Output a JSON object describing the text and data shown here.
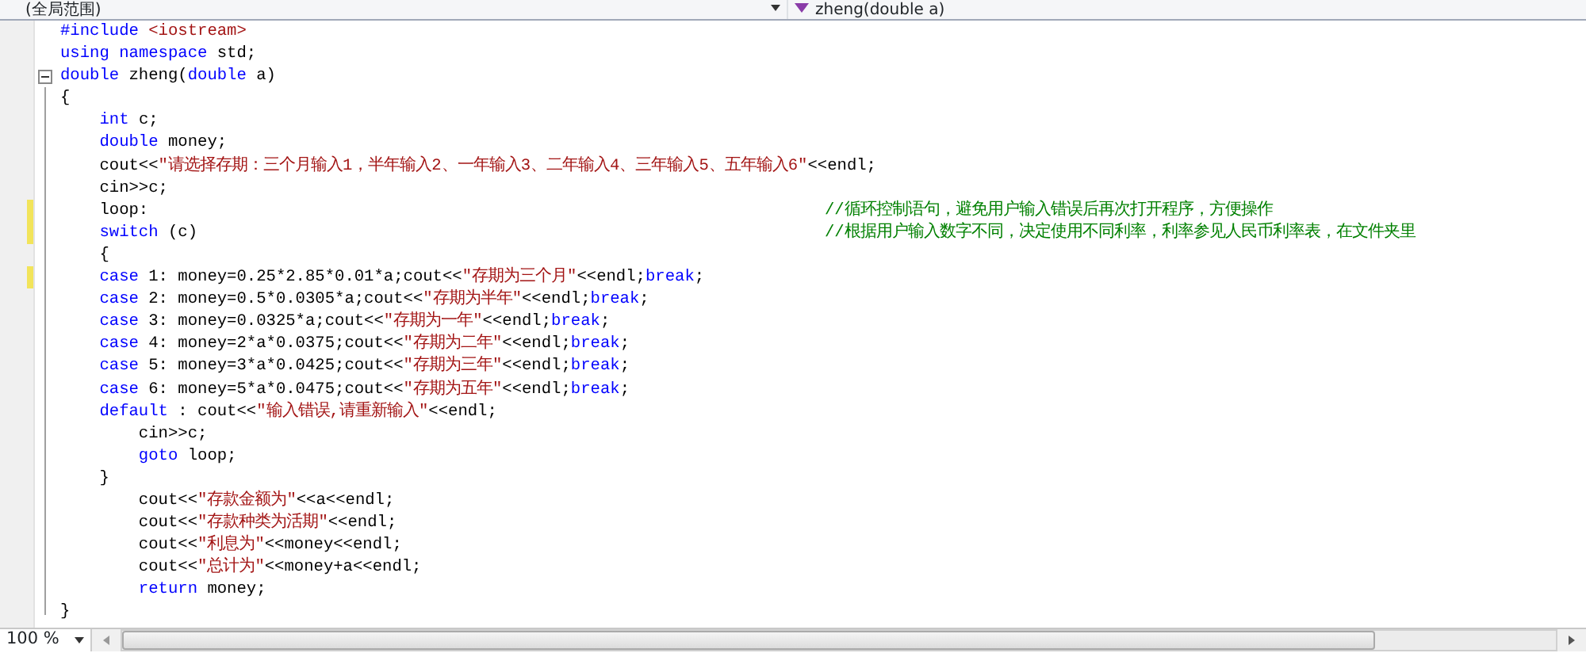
{
  "navigation": {
    "scope": "(全局范围)",
    "member": "zheng(double a)"
  },
  "lines": [
    {
      "changed": false,
      "fold_start": false,
      "tokens": [
        {
          "kind": "kw",
          "text": "#include"
        },
        {
          "kind": "str",
          "text": " <iostream>"
        }
      ]
    },
    {
      "changed": false,
      "fold_start": false,
      "tokens": [
        {
          "kind": "kw",
          "text": "using"
        },
        {
          "kind": "kw",
          "text": " namespace"
        },
        {
          "kind": "plain",
          "text": " std;"
        }
      ]
    },
    {
      "changed": false,
      "fold_start": true,
      "tokens": [
        {
          "kind": "kw",
          "text": "double"
        },
        {
          "kind": "plain",
          "text": " zheng("
        },
        {
          "kind": "kw",
          "text": "double"
        },
        {
          "kind": "plain",
          "text": " a)"
        }
      ]
    },
    {
      "changed": false,
      "fold_start": false,
      "tokens": [
        {
          "kind": "plain",
          "text": "{"
        }
      ]
    },
    {
      "changed": false,
      "fold_start": false,
      "tokens": [
        {
          "kind": "kw",
          "text": "    int"
        },
        {
          "kind": "plain",
          "text": " c;"
        }
      ]
    },
    {
      "changed": false,
      "fold_start": false,
      "tokens": [
        {
          "kind": "kw",
          "text": "    double"
        },
        {
          "kind": "plain",
          "text": " money;"
        }
      ]
    },
    {
      "changed": false,
      "fold_start": false,
      "tokens": [
        {
          "kind": "plain",
          "text": "    cout<<"
        },
        {
          "kind": "str",
          "text": "\"请选择存期：三个月输入1，半年输入2、一年输入3、二年输入4、三年输入5、五年输入6\""
        },
        {
          "kind": "plain",
          "text": "<<endl;"
        }
      ]
    },
    {
      "changed": false,
      "fold_start": false,
      "tokens": [
        {
          "kind": "plain",
          "text": "    cin>>c;"
        }
      ]
    },
    {
      "changed": true,
      "fold_start": false,
      "tokens": [
        {
          "kind": "plain",
          "text": "    loop:                                                                     "
        },
        {
          "kind": "cmt",
          "text": "//循环控制语句，避免用户输入错误后再次打开程序，方便操作"
        }
      ]
    },
    {
      "changed": true,
      "fold_start": false,
      "tokens": [
        {
          "kind": "kw",
          "text": "    switch"
        },
        {
          "kind": "plain",
          "text": " (c)                                                                "
        },
        {
          "kind": "cmt",
          "text": "//根据用户输入数字不同，决定使用不同利率，利率参见人民币利率表，在文件夹里"
        }
      ]
    },
    {
      "changed": false,
      "fold_start": false,
      "tokens": [
        {
          "kind": "plain",
          "text": "    {"
        }
      ]
    },
    {
      "changed": true,
      "fold_start": false,
      "tokens": [
        {
          "kind": "kw",
          "text": "    case"
        },
        {
          "kind": "plain",
          "text": " 1: money=0.25*2.85*0.01*a;cout<<"
        },
        {
          "kind": "str",
          "text": "\"存期为三个月\""
        },
        {
          "kind": "plain",
          "text": "<<endl;"
        },
        {
          "kind": "kw",
          "text": "break"
        },
        {
          "kind": "plain",
          "text": ";"
        }
      ]
    },
    {
      "changed": false,
      "fold_start": false,
      "tokens": [
        {
          "kind": "kw",
          "text": "    case"
        },
        {
          "kind": "plain",
          "text": " 2: money=0.5*0.0305*a;cout<<"
        },
        {
          "kind": "str",
          "text": "\"存期为半年\""
        },
        {
          "kind": "plain",
          "text": "<<endl;"
        },
        {
          "kind": "kw",
          "text": "break"
        },
        {
          "kind": "plain",
          "text": ";"
        }
      ]
    },
    {
      "changed": false,
      "fold_start": false,
      "tokens": [
        {
          "kind": "kw",
          "text": "    case"
        },
        {
          "kind": "plain",
          "text": " 3: money=0.0325*a;cout<<"
        },
        {
          "kind": "str",
          "text": "\"存期为一年\""
        },
        {
          "kind": "plain",
          "text": "<<endl;"
        },
        {
          "kind": "kw",
          "text": "break"
        },
        {
          "kind": "plain",
          "text": ";"
        }
      ]
    },
    {
      "changed": false,
      "fold_start": false,
      "tokens": [
        {
          "kind": "kw",
          "text": "    case"
        },
        {
          "kind": "plain",
          "text": " 4: money=2*a*0.0375;cout<<"
        },
        {
          "kind": "str",
          "text": "\"存期为二年\""
        },
        {
          "kind": "plain",
          "text": "<<endl;"
        },
        {
          "kind": "kw",
          "text": "break"
        },
        {
          "kind": "plain",
          "text": ";"
        }
      ]
    },
    {
      "changed": false,
      "fold_start": false,
      "tokens": [
        {
          "kind": "kw",
          "text": "    case"
        },
        {
          "kind": "plain",
          "text": " 5: money=3*a*0.0425;cout<<"
        },
        {
          "kind": "str",
          "text": "\"存期为三年\""
        },
        {
          "kind": "plain",
          "text": "<<endl;"
        },
        {
          "kind": "kw",
          "text": "break"
        },
        {
          "kind": "plain",
          "text": ";"
        }
      ]
    },
    {
      "changed": false,
      "fold_start": false,
      "tokens": [
        {
          "kind": "kw",
          "text": "    case"
        },
        {
          "kind": "plain",
          "text": " 6: money=5*a*0.0475;cout<<"
        },
        {
          "kind": "str",
          "text": "\"存期为五年\""
        },
        {
          "kind": "plain",
          "text": "<<endl;"
        },
        {
          "kind": "kw",
          "text": "break"
        },
        {
          "kind": "plain",
          "text": ";"
        }
      ]
    },
    {
      "changed": false,
      "fold_start": false,
      "tokens": [
        {
          "kind": "kw",
          "text": "    default"
        },
        {
          "kind": "plain",
          "text": " : cout<<"
        },
        {
          "kind": "str",
          "text": "\"输入错误,请重新输入\""
        },
        {
          "kind": "plain",
          "text": "<<endl;"
        }
      ]
    },
    {
      "changed": false,
      "fold_start": false,
      "tokens": [
        {
          "kind": "plain",
          "text": "        cin>>c;"
        }
      ]
    },
    {
      "changed": false,
      "fold_start": false,
      "tokens": [
        {
          "kind": "kw",
          "text": "        goto"
        },
        {
          "kind": "plain",
          "text": " loop;"
        }
      ]
    },
    {
      "changed": false,
      "fold_start": false,
      "tokens": [
        {
          "kind": "plain",
          "text": "    }"
        }
      ]
    },
    {
      "changed": false,
      "fold_start": false,
      "tokens": [
        {
          "kind": "plain",
          "text": "        cout<<"
        },
        {
          "kind": "str",
          "text": "\"存款金额为\""
        },
        {
          "kind": "plain",
          "text": "<<a<<endl;"
        }
      ]
    },
    {
      "changed": false,
      "fold_start": false,
      "tokens": [
        {
          "kind": "plain",
          "text": "        cout<<"
        },
        {
          "kind": "str",
          "text": "\"存款种类为活期\""
        },
        {
          "kind": "plain",
          "text": "<<endl;"
        }
      ]
    },
    {
      "changed": false,
      "fold_start": false,
      "tokens": [
        {
          "kind": "plain",
          "text": "        cout<<"
        },
        {
          "kind": "str",
          "text": "\"利息为\""
        },
        {
          "kind": "plain",
          "text": "<<money<<endl;"
        }
      ]
    },
    {
      "changed": false,
      "fold_start": false,
      "tokens": [
        {
          "kind": "plain",
          "text": "        cout<<"
        },
        {
          "kind": "str",
          "text": "\"总计为\""
        },
        {
          "kind": "plain",
          "text": "<<money+a<<endl;"
        }
      ]
    },
    {
      "changed": false,
      "fold_start": false,
      "tokens": [
        {
          "kind": "kw",
          "text": "        return"
        },
        {
          "kind": "plain",
          "text": " money;"
        }
      ]
    },
    {
      "changed": false,
      "fold_start": false,
      "tokens": [
        {
          "kind": "plain",
          "text": "}"
        }
      ]
    }
  ],
  "status": {
    "zoom": "100 %"
  }
}
